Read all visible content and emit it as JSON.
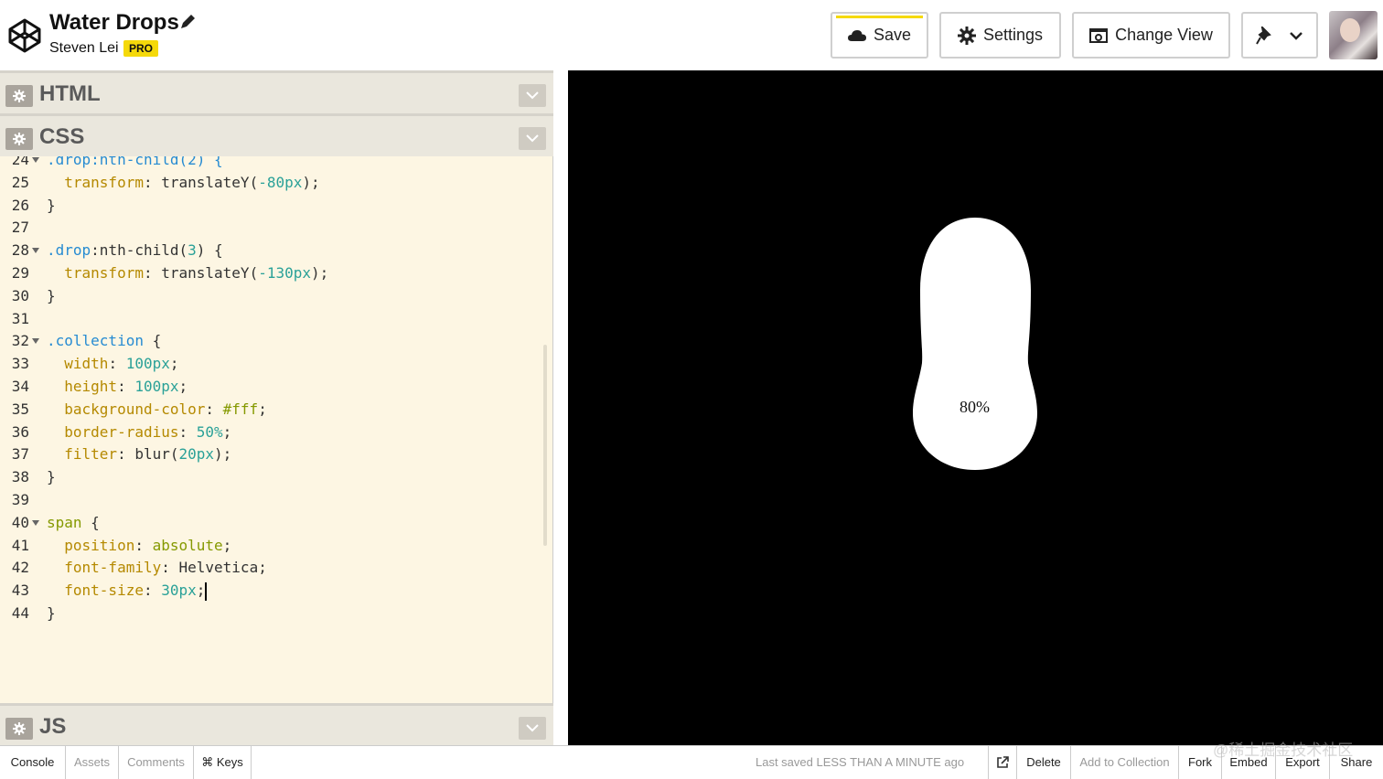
{
  "header": {
    "title": "Water Drops",
    "author": "Steven Lei",
    "badge": "PRO",
    "buttons": {
      "save": "Save",
      "settings": "Settings",
      "change_view": "Change View"
    }
  },
  "panels": {
    "html": "HTML",
    "css": "CSS",
    "js": "JS"
  },
  "code": {
    "lines": [
      {
        "n": "24",
        "fold": true,
        "tokens": [
          {
            "t": ".drop:nth-child(2) {",
            "c": "k-sel"
          }
        ]
      },
      {
        "n": "25",
        "fold": false,
        "tokens": [
          {
            "t": "  transform",
            "c": "k-prop"
          },
          {
            "t": ": translateY(",
            "c": "k-plain"
          },
          {
            "t": "-80px",
            "c": "k-num"
          },
          {
            "t": ");",
            "c": "k-plain"
          }
        ]
      },
      {
        "n": "26",
        "fold": false,
        "tokens": [
          {
            "t": "}",
            "c": "k-plain"
          }
        ]
      },
      {
        "n": "27",
        "fold": false,
        "tokens": []
      },
      {
        "n": "28",
        "fold": true,
        "tokens": [
          {
            "t": ".drop",
            "c": "k-sel"
          },
          {
            "t": ":nth-child(",
            "c": "k-plain"
          },
          {
            "t": "3",
            "c": "k-num"
          },
          {
            "t": ") {",
            "c": "k-plain"
          }
        ]
      },
      {
        "n": "29",
        "fold": false,
        "tokens": [
          {
            "t": "  transform",
            "c": "k-prop"
          },
          {
            "t": ": translateY(",
            "c": "k-plain"
          },
          {
            "t": "-130px",
            "c": "k-num"
          },
          {
            "t": ");",
            "c": "k-plain"
          }
        ]
      },
      {
        "n": "30",
        "fold": false,
        "tokens": [
          {
            "t": "}",
            "c": "k-plain"
          }
        ]
      },
      {
        "n": "31",
        "fold": false,
        "tokens": []
      },
      {
        "n": "32",
        "fold": true,
        "tokens": [
          {
            "t": ".collection",
            "c": "k-sel"
          },
          {
            "t": " {",
            "c": "k-plain"
          }
        ]
      },
      {
        "n": "33",
        "fold": false,
        "tokens": [
          {
            "t": "  width",
            "c": "k-prop"
          },
          {
            "t": ": ",
            "c": "k-plain"
          },
          {
            "t": "100px",
            "c": "k-num"
          },
          {
            "t": ";",
            "c": "k-plain"
          }
        ]
      },
      {
        "n": "34",
        "fold": false,
        "tokens": [
          {
            "t": "  height",
            "c": "k-prop"
          },
          {
            "t": ": ",
            "c": "k-plain"
          },
          {
            "t": "100px",
            "c": "k-num"
          },
          {
            "t": ";",
            "c": "k-plain"
          }
        ]
      },
      {
        "n": "35",
        "fold": false,
        "tokens": [
          {
            "t": "  background-color",
            "c": "k-prop"
          },
          {
            "t": ": ",
            "c": "k-plain"
          },
          {
            "t": "#fff",
            "c": "k-val"
          },
          {
            "t": ";",
            "c": "k-plain"
          }
        ]
      },
      {
        "n": "36",
        "fold": false,
        "tokens": [
          {
            "t": "  border-radius",
            "c": "k-prop"
          },
          {
            "t": ": ",
            "c": "k-plain"
          },
          {
            "t": "50%",
            "c": "k-num"
          },
          {
            "t": ";",
            "c": "k-plain"
          }
        ]
      },
      {
        "n": "37",
        "fold": false,
        "tokens": [
          {
            "t": "  filter",
            "c": "k-prop"
          },
          {
            "t": ": blur(",
            "c": "k-plain"
          },
          {
            "t": "20px",
            "c": "k-num"
          },
          {
            "t": ");",
            "c": "k-plain"
          }
        ]
      },
      {
        "n": "38",
        "fold": false,
        "tokens": [
          {
            "t": "}",
            "c": "k-plain"
          }
        ]
      },
      {
        "n": "39",
        "fold": false,
        "tokens": []
      },
      {
        "n": "40",
        "fold": true,
        "tokens": [
          {
            "t": "span",
            "c": "k-val"
          },
          {
            "t": " {",
            "c": "k-plain"
          }
        ]
      },
      {
        "n": "41",
        "fold": false,
        "tokens": [
          {
            "t": "  position",
            "c": "k-prop"
          },
          {
            "t": ": ",
            "c": "k-plain"
          },
          {
            "t": "absolute",
            "c": "k-val"
          },
          {
            "t": ";",
            "c": "k-plain"
          }
        ]
      },
      {
        "n": "42",
        "fold": false,
        "tokens": [
          {
            "t": "  font-family",
            "c": "k-prop"
          },
          {
            "t": ": Helvetica;",
            "c": "k-plain"
          }
        ]
      },
      {
        "n": "43",
        "fold": false,
        "caret": true,
        "tokens": [
          {
            "t": "  font-size",
            "c": "k-prop"
          },
          {
            "t": ": ",
            "c": "k-plain"
          },
          {
            "t": "30px",
            "c": "k-num"
          },
          {
            "t": ";",
            "c": "k-plain"
          }
        ]
      },
      {
        "n": "44",
        "fold": false,
        "tokens": [
          {
            "t": "}",
            "c": "k-plain"
          }
        ]
      }
    ]
  },
  "preview": {
    "percent_label": "80%"
  },
  "footer": {
    "console": "Console",
    "assets": "Assets",
    "comments": "Comments",
    "keys": "⌘ Keys",
    "last_saved": "Last saved LESS THAN A MINUTE ago",
    "delete": "Delete",
    "add_to_collection": "Add to Collection",
    "fork": "Fork",
    "embed": "Embed",
    "export": "Export",
    "share": "Share"
  },
  "watermark": "@稀土掘金技术社区",
  "colors": {
    "badge": "#f5d90a",
    "editor_bg": "#fdf6e3",
    "preview_bg": "#000000"
  }
}
